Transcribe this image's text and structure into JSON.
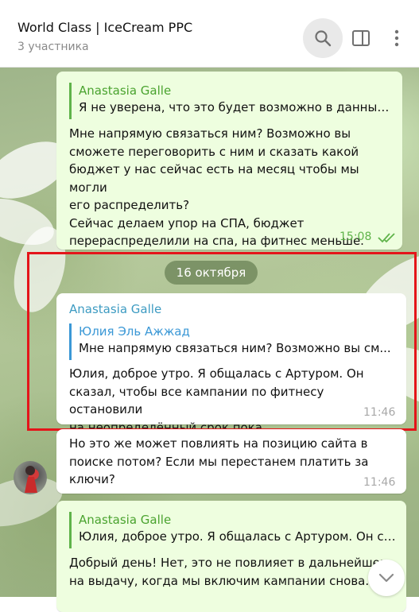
{
  "header": {
    "title": "World Class | IceCream PPC",
    "subtitle": "3 участника",
    "icons": [
      "search-icon",
      "side-panel-icon",
      "more-vertical-icon"
    ]
  },
  "date_separator": "16 октября",
  "messages": [
    {
      "direction": "outgoing",
      "reply": {
        "name": "Anastasia Galle",
        "text": "Я не уверена, что это будет возможно в данный ..."
      },
      "lines": [
        "Мне напрямую связаться ним? Возможно вы",
        "сможете переговорить с ним и сказать какой",
        "бюджет у нас сейчас есть на месяц чтобы мы могли",
        "его распределить?",
        "Сейчас делаем упор на СПА, бюджет",
        "перераспределили на спа, на фитнес меньше."
      ],
      "time": "15:08",
      "status": "read"
    },
    {
      "direction": "incoming",
      "sender": "Anastasia Galle",
      "reply": {
        "name": "Юлия Эль Ажжад",
        "text": "Мне напрямую связаться ним? Возможно вы см..."
      },
      "lines": [
        "Юлия, доброе утро. Я общалась с Артуром. Он",
        "сказал, чтобы все кампании по фитнесу остановили",
        "на неопределённый срок пока"
      ],
      "time": "11:46"
    },
    {
      "direction": "incoming",
      "lines": [
        "Но это же может повлиять на позицию сайта в",
        "поиске потом? Если мы перестанем платить за",
        "ключи?"
      ],
      "time": "11:46"
    },
    {
      "direction": "outgoing",
      "reply": {
        "name": "Anastasia Galle",
        "text": "Юлия, доброе утро. Я общалась с Артуром. Он ск..."
      },
      "lines": [
        "Добрый день! Нет, это не повлияет в дальнейшем",
        "на выдачу, когда мы включим кампании снова."
      ]
    }
  ],
  "colors": {
    "outgoing_bubble": "#eefedf",
    "incoming_bubble": "#ffffff",
    "accent_green": "#4aa32f",
    "accent_blue": "#3b98d6",
    "highlight_border": "#e4151a"
  }
}
